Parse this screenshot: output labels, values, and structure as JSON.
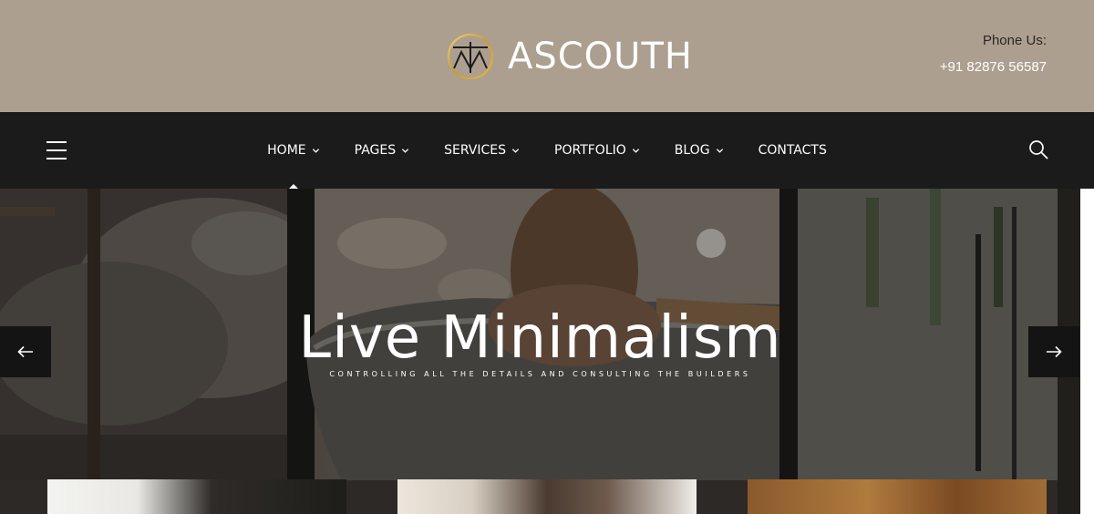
{
  "brand": {
    "name": "ASCOUTH",
    "logo_icon": "monogram-logo-icon",
    "colors": {
      "header_bg": "#ad9f8f",
      "nav_bg": "#1b1b1b",
      "gold": "#c99a2e"
    }
  },
  "contact": {
    "label": "Phone Us:",
    "phone": "+91 82876 56587"
  },
  "nav": {
    "menu_icon": "hamburger-menu-icon",
    "search_icon": "search-icon",
    "items": [
      {
        "label": "HOME",
        "has_dropdown": true,
        "active": true
      },
      {
        "label": "PAGES",
        "has_dropdown": true
      },
      {
        "label": "SERVICES",
        "has_dropdown": true
      },
      {
        "label": "PORTFOLIO",
        "has_dropdown": true
      },
      {
        "label": "BLOG",
        "has_dropdown": true
      },
      {
        "label": "CONTACTS",
        "has_dropdown": false
      }
    ]
  },
  "hero": {
    "title": "Live Minimalism",
    "subtitle": "CONTROLLING ALL THE DETAILS AND CONSULTING THE BUILDERS",
    "prev_icon": "arrow-left-icon",
    "next_icon": "arrow-right-icon"
  }
}
